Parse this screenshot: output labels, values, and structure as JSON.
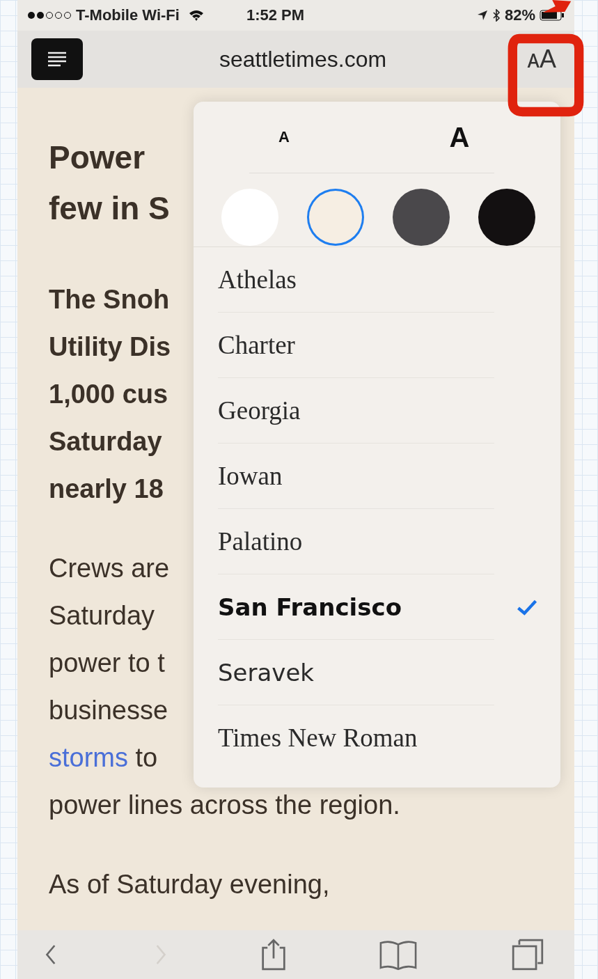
{
  "status_bar": {
    "carrier": "T-Mobile Wi-Fi",
    "time": "1:52 PM",
    "battery": "82%"
  },
  "nav_bar": {
    "url": "seattletimes.com",
    "text_size_button": "ᴀA"
  },
  "article": {
    "headline": [
      "Power",
      "few in S"
    ],
    "lead": [
      "The Snoh",
      "Utility Dis",
      "1,000 cus",
      "Saturday",
      "nearly 18"
    ],
    "body": [
      {
        "text": "Crews are"
      },
      {
        "text": "Saturday"
      },
      {
        "text": "power to t"
      },
      {
        "text": "businesse"
      },
      {
        "text": "to",
        "link": "storms"
      },
      {
        "text": "power lines across the region."
      }
    ],
    "tail": [
      "As of Saturday evening,"
    ]
  },
  "popover": {
    "smaller": "A",
    "larger": "A",
    "themes": [
      {
        "color": "#ffffff",
        "selected": false
      },
      {
        "color": "#f6eee3",
        "selected": true
      },
      {
        "color": "#4a484b",
        "selected": false
      },
      {
        "color": "#131011",
        "selected": false
      }
    ],
    "fonts": [
      {
        "name": "Athelas",
        "kind": "serif",
        "selected": false
      },
      {
        "name": "Charter",
        "kind": "serif",
        "selected": false
      },
      {
        "name": "Georgia",
        "kind": "serif",
        "selected": false
      },
      {
        "name": "Iowan",
        "kind": "serif",
        "selected": false
      },
      {
        "name": "Palatino",
        "kind": "serif",
        "selected": false
      },
      {
        "name": "San Francisco",
        "kind": "sans",
        "selected": true
      },
      {
        "name": "Seravek",
        "kind": "sans",
        "selected": false
      },
      {
        "name": "Times New Roman",
        "kind": "serif",
        "selected": false
      }
    ]
  },
  "toolbar": [
    {
      "kind": "back",
      "disabled": false
    },
    {
      "kind": "forward",
      "disabled": true
    },
    {
      "kind": "share",
      "disabled": false
    },
    {
      "kind": "bookmarks",
      "disabled": false
    },
    {
      "kind": "tabs",
      "disabled": false
    }
  ]
}
